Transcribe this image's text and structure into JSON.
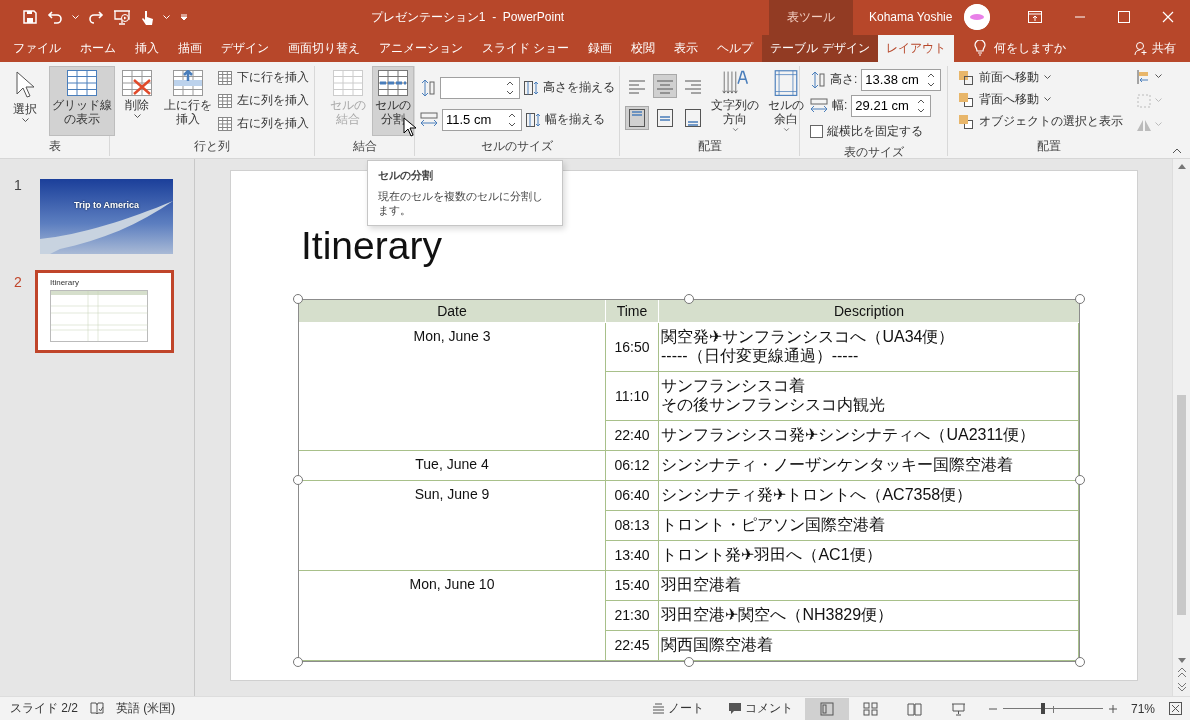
{
  "window": {
    "title": "プレゼンテーション1  -  PowerPoint",
    "context_group": "表ツール",
    "user": "Kohama Yoshie"
  },
  "tabs": [
    {
      "label": "ファイル",
      "kind": "normal",
      "selected": false
    },
    {
      "label": "ホーム",
      "kind": "normal",
      "selected": false
    },
    {
      "label": "挿入",
      "kind": "normal",
      "selected": false
    },
    {
      "label": "描画",
      "kind": "normal",
      "selected": false
    },
    {
      "label": "デザイン",
      "kind": "normal",
      "selected": false
    },
    {
      "label": "画面切り替え",
      "kind": "normal",
      "selected": false
    },
    {
      "label": "アニメーション",
      "kind": "normal",
      "selected": false
    },
    {
      "label": "スライド ショー",
      "kind": "normal",
      "selected": false
    },
    {
      "label": "録画",
      "kind": "normal",
      "selected": false
    },
    {
      "label": "校閲",
      "kind": "normal",
      "selected": false
    },
    {
      "label": "表示",
      "kind": "normal",
      "selected": false
    },
    {
      "label": "ヘルプ",
      "kind": "normal",
      "selected": false
    },
    {
      "label": "テーブル デザイン",
      "kind": "context",
      "selected": false
    },
    {
      "label": "レイアウト",
      "kind": "context",
      "selected": true
    }
  ],
  "tell_me": "何をしますか",
  "share": "共有",
  "ribbon": {
    "table": {
      "label": "表",
      "buttons": [
        {
          "label": "選択",
          "highlighted": false,
          "disabled": false
        },
        {
          "label": "グリッド線の表示",
          "highlighted": true,
          "disabled": false
        }
      ]
    },
    "rows_columns": {
      "label": "行と列",
      "buttons": [
        {
          "label": "削除",
          "highlighted": false,
          "disabled": false
        },
        {
          "label": "上に行を挿入",
          "highlighted": false,
          "disabled": false
        }
      ],
      "small_buttons": [
        "下に行を挿入",
        "左に列を挿入",
        "右に列を挿入"
      ]
    },
    "merge": {
      "label": "結合",
      "buttons": [
        {
          "label": "セルの結合",
          "highlighted": false,
          "disabled": true
        },
        {
          "label": "セルの分割",
          "highlighted": true,
          "disabled": false
        }
      ]
    },
    "cell_size": {
      "label": "セルのサイズ",
      "width_value": "11.5 cm",
      "distribute_rows": "高さを揃える",
      "distribute_columns": "幅を揃える"
    },
    "alignment": {
      "label": "配置",
      "horizontal": [
        {
          "selected": false
        },
        {
          "selected": true
        },
        {
          "selected": false
        }
      ],
      "vertical": [
        {
          "selected": true
        },
        {
          "selected": false
        },
        {
          "selected": false
        }
      ],
      "text_direction": "文字列の方向",
      "cell_margins": "セルの余白"
    },
    "table_size": {
      "label": "表のサイズ",
      "height_label": "高さ:",
      "height_value": "13.38 cm",
      "width_label": "幅:",
      "width_value": "29.21 cm",
      "lock_aspect": {
        "label": "縦横比を固定する",
        "checked": false
      }
    },
    "arrange": {
      "label": "配置",
      "bring_forward": "前面へ移動",
      "send_backward": "背面へ移動",
      "selection_pane": "オブジェクトの選択と表示"
    }
  },
  "tooltip": {
    "title": "セルの分割",
    "text": "現在のセルを複数のセルに分割します。"
  },
  "slides": [
    {
      "number": "1",
      "title": "Trip to America",
      "selected": false
    },
    {
      "number": "2",
      "title": "Itinerary",
      "selected": true
    }
  ],
  "slide": {
    "title": "Itinerary",
    "columns": [
      "Date",
      "Time",
      "Description"
    ],
    "groups": [
      {
        "date": "Mon, June 3",
        "entries": [
          {
            "time": "16:50",
            "description": [
              "関空発✈サンフランシスコへ（UA34便）",
              "-----（日付変更線通過）-----"
            ]
          },
          {
            "time": "11:10",
            "description": [
              "サンフランシスコ着",
              "その後サンフランシスコ内観光"
            ]
          },
          {
            "time": "22:40",
            "description": [
              "サンフランシスコ発✈シンシナティへ（UA2311便）"
            ]
          }
        ]
      },
      {
        "date": "Tue, June 4",
        "entries": [
          {
            "time": "06:12",
            "description": [
              "シンシナティ・ノーザンケンタッキー国際空港着"
            ]
          }
        ]
      },
      {
        "date": "Sun, June 9",
        "entries": [
          {
            "time": "06:40",
            "description": [
              "シンシナティ発✈トロントへ（AC7358便）"
            ]
          },
          {
            "time": "08:13",
            "description": [
              "トロント・ピアソン国際空港着"
            ]
          },
          {
            "time": "13:40",
            "description": [
              "トロント発✈羽田へ（AC1便）"
            ]
          }
        ]
      },
      {
        "date": "Mon, June 10",
        "entries": [
          {
            "time": "15:40",
            "description": [
              "羽田空港着"
            ]
          },
          {
            "time": "21:30",
            "description": [
              "羽田空港✈関空へ（NH3829便）"
            ]
          },
          {
            "time": "22:45",
            "description": [
              "関西国際空港着"
            ]
          }
        ]
      }
    ]
  },
  "status_bar": {
    "slide": "スライド 2/2",
    "language": "英語 (米国)",
    "notes": "ノート",
    "comments": "コメント",
    "views": [
      {
        "selected": true
      },
      {
        "selected": false
      },
      {
        "selected": false
      },
      {
        "selected": false
      }
    ],
    "zoom_slider": {
      "level": 0.4
    },
    "zoom": "71%"
  }
}
